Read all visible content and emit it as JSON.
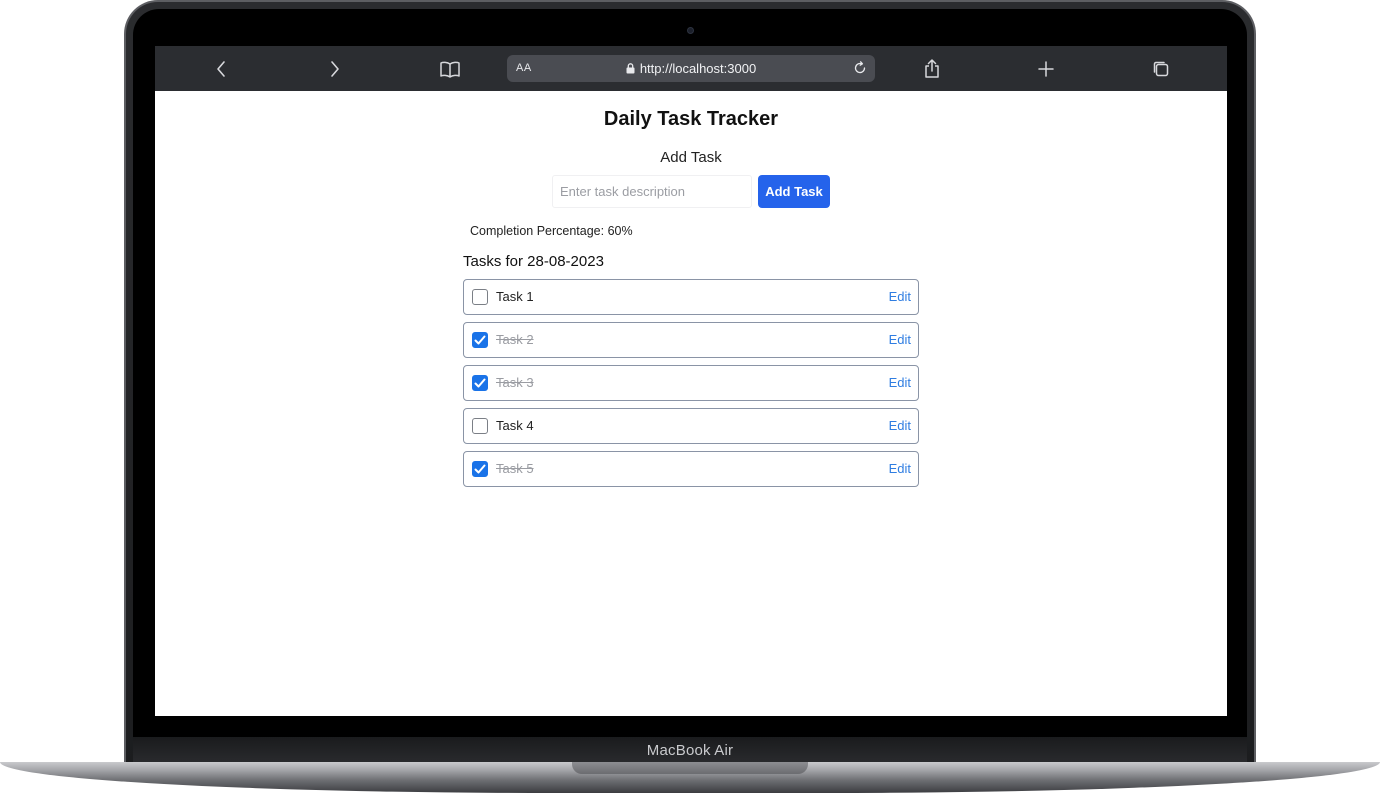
{
  "device": {
    "label": "MacBook Air"
  },
  "browser": {
    "text_size_label": "AA",
    "url": "http://localhost:3000",
    "icons": {
      "back": "chevron-left-icon",
      "forward": "chevron-right-icon",
      "bookmarks": "book-icon",
      "lock": "lock-icon",
      "reload": "reload-icon",
      "share": "share-icon",
      "new_tab": "plus-icon",
      "tabs": "tabs-icon"
    }
  },
  "app": {
    "title": "Daily Task Tracker",
    "add_section_heading": "Add Task",
    "input": {
      "placeholder": "Enter task description",
      "value": ""
    },
    "add_button_label": "Add Task",
    "completion_text": "Completion Percentage: 60%",
    "completion_percent": 60,
    "list_heading": "Tasks for 28-08-2023",
    "edit_label": "Edit",
    "tasks": [
      {
        "label": "Task 1",
        "done": false
      },
      {
        "label": "Task 2",
        "done": true
      },
      {
        "label": "Task 3",
        "done": true
      },
      {
        "label": "Task 4",
        "done": false
      },
      {
        "label": "Task 5",
        "done": true
      }
    ]
  },
  "colors": {
    "accent": "#2563eb",
    "checkbox_checked": "#1a73e8",
    "link": "#2f7de1",
    "toolbar": "#2b2d31"
  }
}
